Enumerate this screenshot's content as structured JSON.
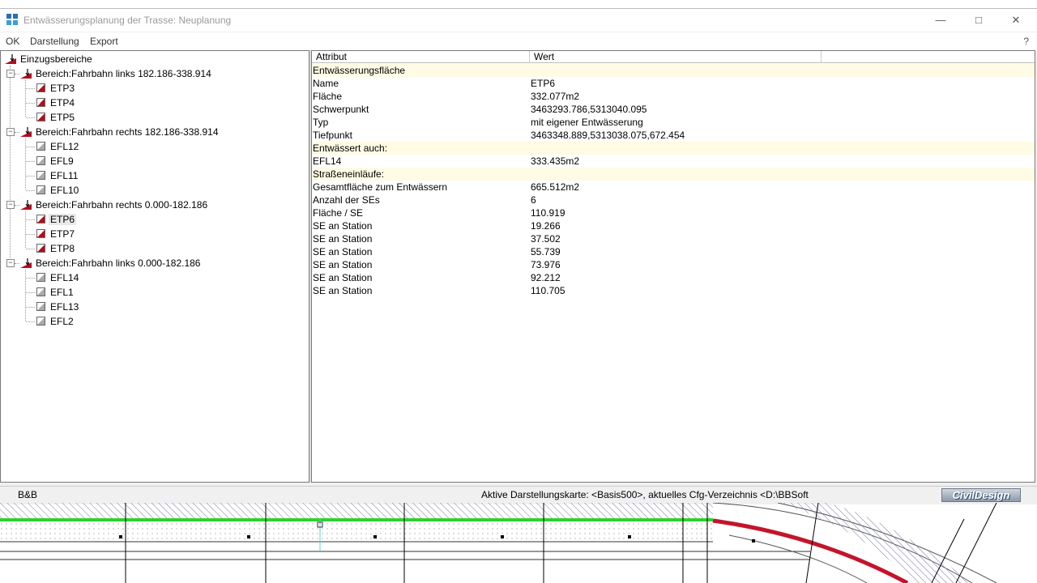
{
  "window": {
    "title": "Entwässerungsplanung der Trasse: Neuplanung"
  },
  "menu": [
    "OK",
    "Darstellung",
    "Export"
  ],
  "help_label": "?",
  "tree": {
    "root": "Einzugsbereiche",
    "groups": [
      {
        "label": "Bereich:Fahrbahn links 182.186-338.914",
        "items": [
          "ETP3",
          "ETP4",
          "ETP5"
        ],
        "type": "etp"
      },
      {
        "label": "Bereich:Fahrbahn rechts 182.186-338.914",
        "items": [
          "EFL12",
          "EFL9",
          "EFL11",
          "EFL10"
        ],
        "type": "efl"
      },
      {
        "label": "Bereich:Fahrbahn rechts 0.000-182.186",
        "items": [
          "ETP6",
          "ETP7",
          "ETP8"
        ],
        "type": "etp"
      },
      {
        "label": "Bereich:Fahrbahn links 0.000-182.186",
        "items": [
          "EFL14",
          "EFL1",
          "EFL13",
          "EFL2"
        ],
        "type": "efl"
      }
    ],
    "selected": "ETP6"
  },
  "table": {
    "headers": [
      "Attribut",
      "Wert"
    ],
    "rows": [
      {
        "attr": "Entwässerungsfläche",
        "value": "",
        "section": true
      },
      {
        "attr": "Name",
        "value": "ETP6"
      },
      {
        "attr": "Fläche",
        "value": "332.077m2"
      },
      {
        "attr": "Schwerpunkt",
        "value": "3463293.786,5313040.095"
      },
      {
        "attr": "Typ",
        "value": "mit eigener Entwässerung"
      },
      {
        "attr": "Tiefpunkt",
        "value": "3463348.889,5313038.075,672.454"
      },
      {
        "attr": "Entwässert auch:",
        "value": "",
        "section": true
      },
      {
        "attr": "EFL14",
        "value": "333.435m2"
      },
      {
        "attr": "Straßeneinläufe:",
        "value": "",
        "section": true
      },
      {
        "attr": "Gesamtfläche zum Entwässern",
        "value": "665.512m2"
      },
      {
        "attr": "Anzahl der SEs",
        "value": "6"
      },
      {
        "attr": "Fläche / SE",
        "value": "110.919"
      },
      {
        "attr": "SE an Station",
        "value": "19.266"
      },
      {
        "attr": "SE an Station",
        "value": "37.502"
      },
      {
        "attr": "SE an Station",
        "value": "55.739"
      },
      {
        "attr": "SE an Station",
        "value": "73.976"
      },
      {
        "attr": "SE an Station",
        "value": "92.212"
      },
      {
        "attr": "SE an Station",
        "value": "110.705"
      }
    ]
  },
  "status": {
    "left": "B&B",
    "right": "Aktive Darstellungskarte: <Basis500>, aktuelles Cfg-Verzeichnis <D:\\BBSoft",
    "logo": "CivilDesign"
  },
  "colors": {
    "section_bg": "#fffbe4",
    "etp_icon": "#b10e1e",
    "road_green": "#2fd12f",
    "road_red": "#c4142b"
  }
}
